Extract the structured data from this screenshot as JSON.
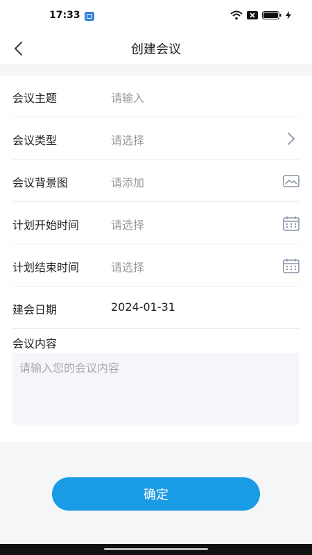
{
  "status_bar": {
    "time": "17:33",
    "icons": [
      "app-notification-icon",
      "wifi-icon",
      "signal-x-icon",
      "battery-icon",
      "charging-icon"
    ]
  },
  "nav": {
    "title": "创建会议",
    "back_icon": "chevron-left-icon"
  },
  "form": {
    "rows": [
      {
        "label": "会议主题",
        "value": "请输入",
        "icon": ""
      },
      {
        "label": "会议类型",
        "value": "请选择",
        "icon": "chevron-right-icon"
      },
      {
        "label": "会议背景图",
        "value": "请添加",
        "icon": "image-icon"
      },
      {
        "label": "计划开始时间",
        "value": "请选择",
        "icon": "calendar-icon"
      },
      {
        "label": "计划结束时间",
        "value": "请选择",
        "icon": "calendar-icon"
      },
      {
        "label": "建会日期",
        "value": "2024-01-31",
        "icon": ""
      }
    ],
    "content": {
      "label": "会议内容",
      "placeholder": "请输入您的会议内容",
      "value": ""
    }
  },
  "actions": {
    "confirm_label": "确定"
  },
  "colors": {
    "accent": "#1a9be6",
    "placeholder": "#9a9a9a",
    "icon": "#8a94a6"
  }
}
